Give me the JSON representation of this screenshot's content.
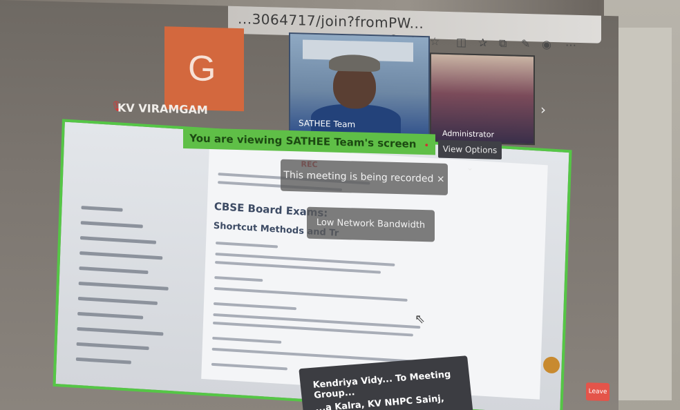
{
  "browser": {
    "url_fragment": "...3064717/join?fromPW...",
    "icons": [
      "mic-icon",
      "text-size-icon",
      "star-icon",
      "split-view-icon",
      "favorites-icon",
      "collections-icon",
      "extensions-icon",
      "profile-icon",
      "menu-icon"
    ]
  },
  "participants": [
    {
      "initial": "G",
      "name": "KV VIRAMGAM",
      "tile_color": "#d3683e"
    },
    {
      "name": "SATHEE Team"
    },
    {
      "name": "Administrator"
    }
  ],
  "share": {
    "banner_text": "You are viewing SATHEE Team's screen",
    "rec_label": "• REC",
    "view_options_label": "View Options ⌄",
    "accent_color": "#5fbf47"
  },
  "document": {
    "heading": "CBSE Board Exams:",
    "subheading": "Shortcut Methods and Tr"
  },
  "notifications": {
    "recording": "This meeting is being recorded",
    "close_glyph": "×",
    "network": "Low Network Bandwidth"
  },
  "chat": {
    "line1": "Kendriya Vidy... To Meeting Group...",
    "line2": "...a Kalra, KV NHPC Sainj,"
  },
  "controls": {
    "leave_label": "Leave",
    "leave_color": "#e4544a"
  }
}
